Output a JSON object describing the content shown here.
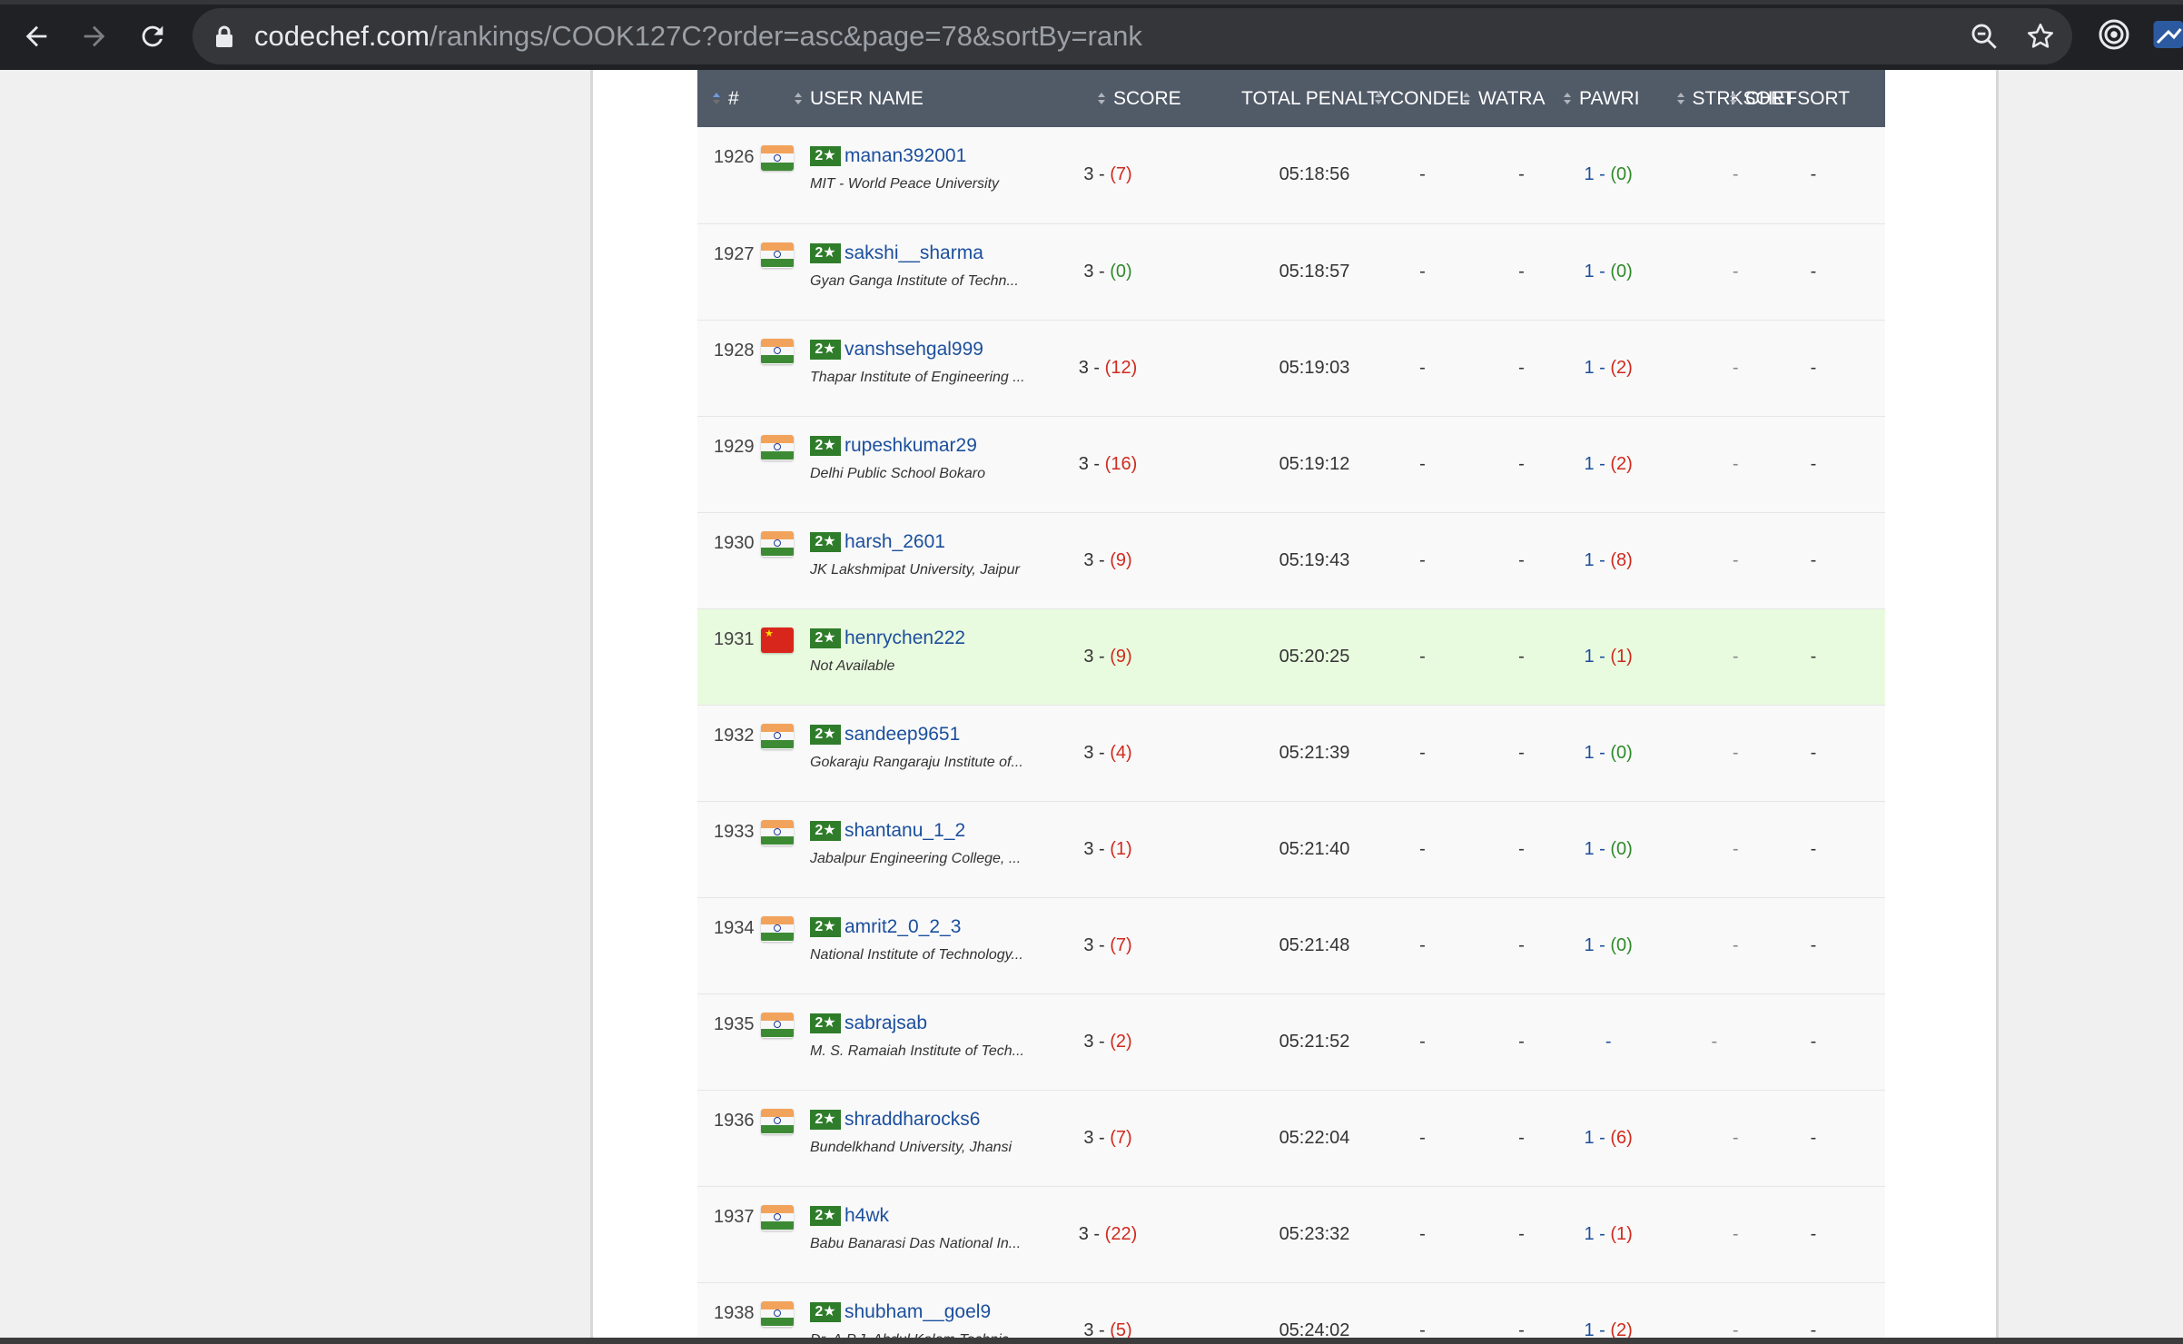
{
  "browser": {
    "url_host": "codechef.com",
    "url_path": "/rankings/COOK127C?order=asc&page=78&sortBy=rank"
  },
  "table": {
    "headers": {
      "rank": "#",
      "user": "USER NAME",
      "score": "SCORE",
      "penalty": "TOTAL PENALTY",
      "condel": "CONDEL",
      "watra": "WATRA",
      "pawri": "PAWRI",
      "strksort": "STRKSORT",
      "chefsort": "CHEFSORT"
    },
    "badge": "2★",
    "rows": [
      {
        "rank": "1926",
        "flag": "in",
        "username": "manan392001",
        "institution": "MIT - World Peace University",
        "score_main": "3 - ",
        "score_pen": "(7)",
        "score_pen_color": "red",
        "time": "05:18:56",
        "condel": "-",
        "watra": "-",
        "pawri_main": "1 - ",
        "pawri_pen": "(0)",
        "pawri_pen_color": "green",
        "strksort": "-",
        "chefsort": "-"
      },
      {
        "rank": "1927",
        "flag": "in",
        "username": "sakshi__sharma",
        "institution": "Gyan Ganga Institute of Techn...",
        "score_main": "3 - ",
        "score_pen": "(0)",
        "score_pen_color": "green",
        "time": "05:18:57",
        "condel": "-",
        "watra": "-",
        "pawri_main": "1 - ",
        "pawri_pen": "(0)",
        "pawri_pen_color": "green",
        "strksort": "-",
        "chefsort": "-"
      },
      {
        "rank": "1928",
        "flag": "in",
        "username": "vanshsehgal999",
        "institution": "Thapar Institute of Engineering ...",
        "score_main": "3 - ",
        "score_pen": "(12)",
        "score_pen_color": "red",
        "time": "05:19:03",
        "condel": "-",
        "watra": "-",
        "pawri_main": "1 - ",
        "pawri_pen": "(2)",
        "pawri_pen_color": "red",
        "strksort": "-",
        "chefsort": "-"
      },
      {
        "rank": "1929",
        "flag": "in",
        "username": "rupeshkumar29",
        "institution": "Delhi Public School Bokaro",
        "score_main": "3 - ",
        "score_pen": "(16)",
        "score_pen_color": "red",
        "time": "05:19:12",
        "condel": "-",
        "watra": "-",
        "pawri_main": "1 - ",
        "pawri_pen": "(2)",
        "pawri_pen_color": "red",
        "strksort": "-",
        "chefsort": "-"
      },
      {
        "rank": "1930",
        "flag": "in",
        "username": "harsh_2601",
        "institution": "JK Lakshmipat University, Jaipur",
        "score_main": "3 - ",
        "score_pen": "(9)",
        "score_pen_color": "red",
        "time": "05:19:43",
        "condel": "-",
        "watra": "-",
        "pawri_main": "1 - ",
        "pawri_pen": "(8)",
        "pawri_pen_color": "red",
        "strksort": "-",
        "chefsort": "-"
      },
      {
        "rank": "1931",
        "flag": "cn",
        "highlight": true,
        "username": "henrychen222",
        "institution": "Not Available",
        "score_main": "3 - ",
        "score_pen": "(9)",
        "score_pen_color": "red",
        "time": "05:20:25",
        "condel": "-",
        "watra": "-",
        "pawri_main": "1 - ",
        "pawri_pen": "(1)",
        "pawri_pen_color": "red",
        "strksort": "-",
        "chefsort": "-"
      },
      {
        "rank": "1932",
        "flag": "in",
        "username": "sandeep9651",
        "institution": "Gokaraju Rangaraju Institute of...",
        "score_main": "3 - ",
        "score_pen": "(4)",
        "score_pen_color": "red",
        "time": "05:21:39",
        "condel": "-",
        "watra": "-",
        "pawri_main": "1 - ",
        "pawri_pen": "(0)",
        "pawri_pen_color": "green",
        "strksort": "-",
        "chefsort": "-"
      },
      {
        "rank": "1933",
        "flag": "in",
        "username": "shantanu_1_2",
        "institution": "Jabalpur Engineering College, ...",
        "score_main": "3 - ",
        "score_pen": "(1)",
        "score_pen_color": "red",
        "time": "05:21:40",
        "condel": "-",
        "watra": "-",
        "pawri_main": "1 - ",
        "pawri_pen": "(0)",
        "pawri_pen_color": "green",
        "strksort": "-",
        "chefsort": "-"
      },
      {
        "rank": "1934",
        "flag": "in",
        "username": "amrit2_0_2_3",
        "institution": "National Institute of Technology...",
        "score_main": "3 - ",
        "score_pen": "(7)",
        "score_pen_color": "red",
        "time": "05:21:48",
        "condel": "-",
        "watra": "-",
        "pawri_main": "1 - ",
        "pawri_pen": "(0)",
        "pawri_pen_color": "green",
        "strksort": "-",
        "chefsort": "-"
      },
      {
        "rank": "1935",
        "flag": "in",
        "username": "sabrajsab",
        "institution": "M. S. Ramaiah Institute of Tech...",
        "score_main": "3 - ",
        "score_pen": "(2)",
        "score_pen_color": "red",
        "time": "05:21:52",
        "condel": "-",
        "watra": "-",
        "pawri_main": "-",
        "pawri_pen": "",
        "pawri_pen_color": "green",
        "strksort": "-",
        "chefsort": "-"
      },
      {
        "rank": "1936",
        "flag": "in",
        "username": "shraddharocks6",
        "institution": "Bundelkhand University, Jhansi",
        "score_main": "3 - ",
        "score_pen": "(7)",
        "score_pen_color": "red",
        "time": "05:22:04",
        "condel": "-",
        "watra": "-",
        "pawri_main": "1 - ",
        "pawri_pen": "(6)",
        "pawri_pen_color": "red",
        "strksort": "-",
        "chefsort": "-"
      },
      {
        "rank": "1937",
        "flag": "in",
        "username": "h4wk",
        "institution": "Babu Banarasi Das National In...",
        "score_main": "3 - ",
        "score_pen": "(22)",
        "score_pen_color": "red",
        "time": "05:23:32",
        "condel": "-",
        "watra": "-",
        "pawri_main": "1 - ",
        "pawri_pen": "(1)",
        "pawri_pen_color": "red",
        "strksort": "-",
        "chefsort": "-"
      },
      {
        "rank": "1938",
        "flag": "in",
        "username": "shubham__goel9",
        "institution": "Dr. A.P.J. Abdul Kalam Technical...",
        "score_main": "3 - ",
        "score_pen": "(5)",
        "score_pen_color": "red",
        "time": "05:24:02",
        "condel": "-",
        "watra": "-",
        "pawri_main": "1 - ",
        "pawri_pen": "(2)",
        "pawri_pen_color": "red",
        "strksort": "-",
        "chefsort": "-"
      }
    ]
  }
}
